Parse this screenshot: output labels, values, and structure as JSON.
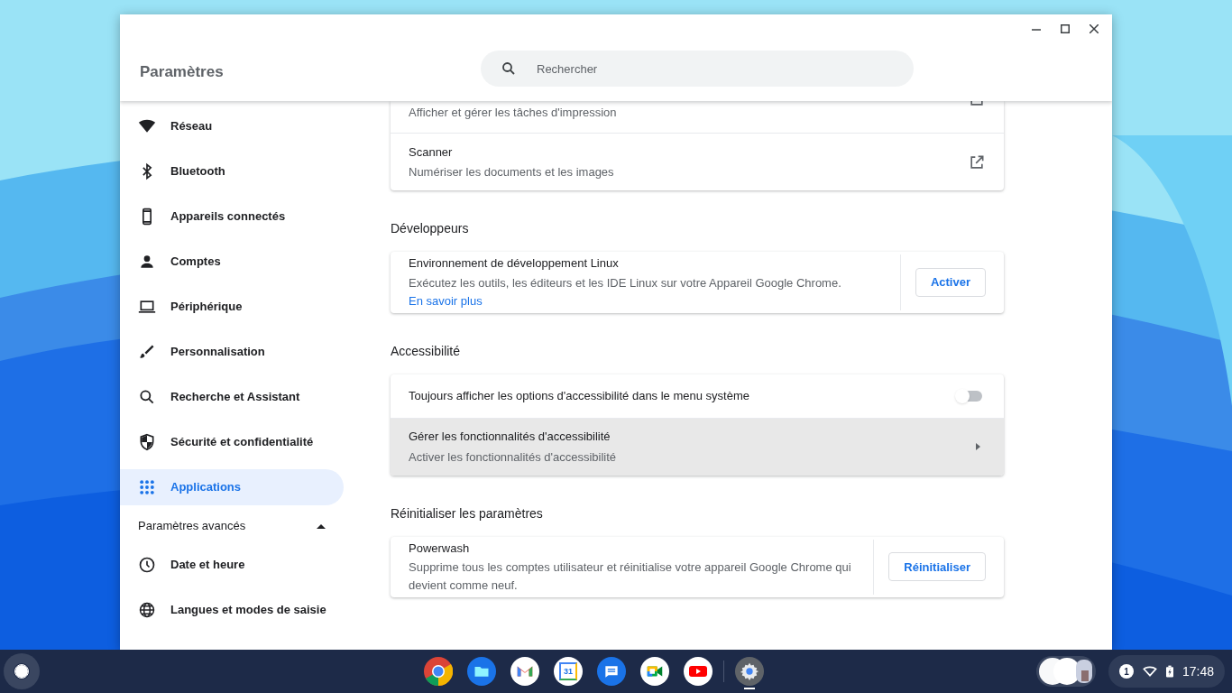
{
  "window": {
    "title": "Paramètres",
    "search": {
      "placeholder": "Rechercher"
    }
  },
  "sidebar": {
    "items": [
      {
        "label": "Réseau",
        "selected": false
      },
      {
        "label": "Bluetooth",
        "selected": false
      },
      {
        "label": "Appareils connectés",
        "selected": false
      },
      {
        "label": "Comptes",
        "selected": false
      },
      {
        "label": "Périphérique",
        "selected": false
      },
      {
        "label": "Personnalisation",
        "selected": false
      },
      {
        "label": "Recherche et Assistant",
        "selected": false
      },
      {
        "label": "Sécurité et confidentialité",
        "selected": false
      },
      {
        "label": "Applications",
        "selected": true
      }
    ],
    "advanced": {
      "label": "Paramètres avancés",
      "expanded": true,
      "items": [
        {
          "label": "Date et heure",
          "selected": false
        },
        {
          "label": "Langues et modes de saisie",
          "selected": false
        }
      ]
    }
  },
  "top_card": {
    "rows": [
      {
        "kind": "partial",
        "subtitle": "Afficher et gérer les tâches d'impression"
      },
      {
        "kind": "external",
        "title": "Scanner",
        "subtitle": "Numériser les documents et les images"
      }
    ]
  },
  "sections": [
    {
      "title": "Développeurs",
      "rows": [
        {
          "kind": "button",
          "title": "Environnement de développement Linux",
          "subtitle": "Exécutez les outils, les éditeurs et les IDE Linux sur votre Appareil Google Chrome.",
          "link": "En savoir plus",
          "button": "Activer"
        }
      ]
    },
    {
      "title": "Accessibilité",
      "rows": [
        {
          "kind": "toggle",
          "title": "Toujours afficher les options d'accessibilité dans le menu système",
          "on": false
        },
        {
          "kind": "arrow",
          "title": "Gérer les fonctionnalités d'accessibilité",
          "subtitle": "Activer les fonctionnalités d'accessibilité",
          "hovered": true
        }
      ]
    },
    {
      "title": "Réinitialiser les paramètres",
      "rows": [
        {
          "kind": "button",
          "title": "Powerwash",
          "subtitle": "Supprime tous les comptes utilisateur et réinitialise votre appareil Google Chrome qui devient comme neuf.",
          "button": "Réinitialiser"
        }
      ]
    }
  ],
  "taskbar": {
    "apps": [
      {
        "kind": "browser",
        "active": false
      },
      {
        "kind": "files",
        "active": false
      },
      {
        "kind": "mail",
        "active": false
      },
      {
        "kind": "calendar",
        "day": "31",
        "active": false
      },
      {
        "kind": "chat",
        "active": false
      },
      {
        "kind": "video",
        "active": false
      },
      {
        "kind": "play",
        "active": false
      },
      {
        "kind": "settings",
        "active": true
      }
    ],
    "status": {
      "notifications": "1",
      "time": "17:48"
    }
  }
}
